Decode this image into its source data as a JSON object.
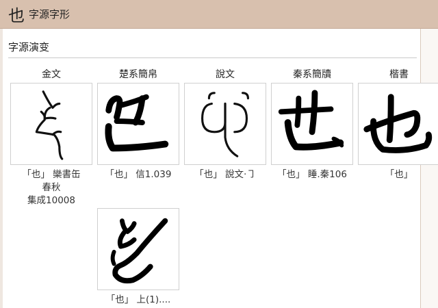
{
  "header": {
    "title_char": "也",
    "title_text": "字源字形"
  },
  "section": {
    "title": "字源演变"
  },
  "columns": [
    {
      "label": "金文"
    },
    {
      "label": "楚系簡帛"
    },
    {
      "label": "說文"
    },
    {
      "label": "秦系簡牘"
    },
    {
      "label": "楷書"
    }
  ],
  "cards": [
    {
      "caption_lines": [
        "「也」 欒書缶",
        "春秋",
        "集成10008"
      ],
      "glyph_icon": "bronze-inscription-ye-icon"
    },
    {
      "caption_lines": [
        "「也」 信1.039"
      ],
      "glyph_icon": "chu-bamboo-ye-icon"
    },
    {
      "caption_lines": [
        "「也」 說文‧㇆"
      ],
      "glyph_icon": "shuowen-ye-icon"
    },
    {
      "caption_lines": [
        "「也」 睡.秦106"
      ],
      "glyph_icon": "qin-bamboo-ye-icon"
    },
    {
      "caption_lines": [
        "「也」"
      ],
      "glyph_icon": "regular-script-ye-icon"
    },
    {
      "caption_lines": [
        "「也」 上(1)...."
      ],
      "glyph_icon": "chu-variant-ye-icon"
    }
  ]
}
